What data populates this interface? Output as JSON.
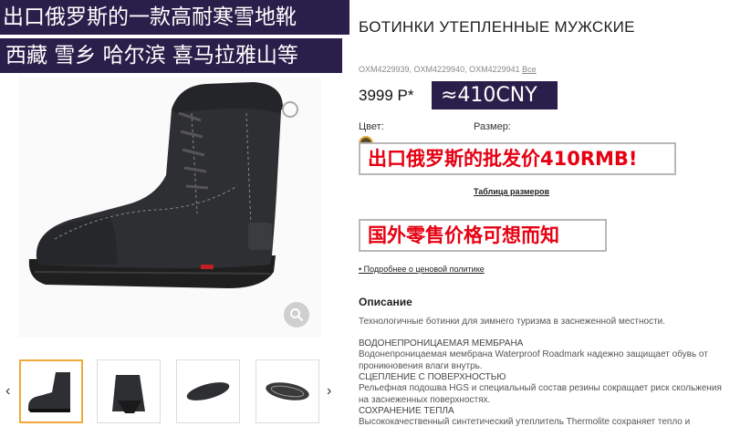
{
  "overlays": {
    "line1": "出口俄罗斯的一款高耐寒雪地靴",
    "line2": "西藏 雪乡 哈尔滨 喜马拉雅山等",
    "cny": "≈410CNY",
    "wholesale": "出口俄罗斯的批发价410RMB!",
    "retail": "国外零售价格可想而知"
  },
  "product": {
    "title": "БОТИНКИ УТЕПЛЕННЫЕ МУЖСКИЕ",
    "skus": "OXM4229939, OXM4229940, OXM4229941",
    "skus_link": "Все",
    "price": "3999 P*",
    "color_label": "Цвет:",
    "size_label": "Размер:",
    "size_table_link": "Таблица размеров",
    "price_policy_link": "Подробнее о ценовой политике"
  },
  "description": {
    "heading": "Описание",
    "intro": "Технологичные ботинки для зимнего туризма в заснеженной местности.",
    "items": [
      {
        "title": "ВОДОНЕПРОНИЦАЕМАЯ МЕМБРАНА",
        "text": "Водонепроницаемая мембрана Waterproof Roadmark надежно защищает обувь от проникновения влаги внутрь."
      },
      {
        "title": "СЦЕПЛЕНИЕ С ПОВЕРХНОСТЬЮ",
        "text": "Рельефная подошва HGS и специальный состав резины сокращает риск скольжения на заснеженных поверхностях."
      },
      {
        "title": "СОХРАНЕНИЕ ТЕПЛА",
        "text": "Высококачественный синтетический утеплитель Thermolite сохраняет тепло и"
      }
    ]
  },
  "gallery": {
    "prev_icon": "chevron-left-icon",
    "next_icon": "chevron-right-icon",
    "zoom_icon": "magnifier-icon",
    "thumbnails": [
      "boot-side-view",
      "boot-front-view",
      "boot-top-view",
      "boot-sole-view"
    ]
  },
  "colors": {
    "banner_bg": "#2a1f4a",
    "note_text": "#e60012",
    "active_thumb_border": "#f0a93a"
  }
}
